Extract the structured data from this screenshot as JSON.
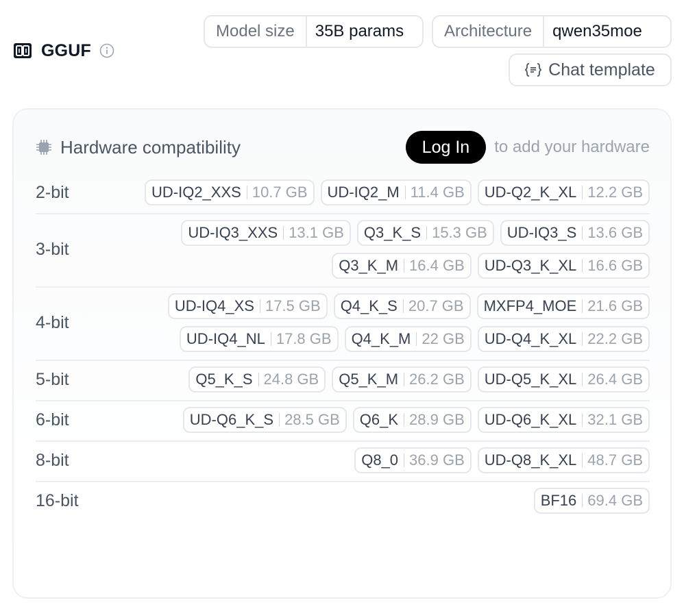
{
  "header": {
    "title": "GGUF",
    "model_size_label": "Model size",
    "model_size_value": "35B params",
    "architecture_label": "Architecture",
    "architecture_value": "qwen35moe",
    "chat_template_label": "Chat template"
  },
  "hardware": {
    "title": "Hardware compatibility",
    "login_label": "Log In",
    "hint": "to add your hardware"
  },
  "quant_rows": [
    {
      "bits": "2-bit",
      "items": [
        {
          "name": "UD-IQ2_XXS",
          "size": "10.7 GB"
        },
        {
          "name": "UD-IQ2_M",
          "size": "11.4 GB"
        },
        {
          "name": "UD-Q2_K_XL",
          "size": "12.2 GB"
        }
      ]
    },
    {
      "bits": "3-bit",
      "items": [
        {
          "name": "UD-IQ3_XXS",
          "size": "13.1 GB"
        },
        {
          "name": "Q3_K_S",
          "size": "15.3 GB"
        },
        {
          "name": "UD-IQ3_S",
          "size": "13.6 GB"
        },
        {
          "name": "Q3_K_M",
          "size": "16.4 GB"
        },
        {
          "name": "UD-Q3_K_XL",
          "size": "16.6 GB"
        }
      ]
    },
    {
      "bits": "4-bit",
      "items": [
        {
          "name": "UD-IQ4_XS",
          "size": "17.5 GB"
        },
        {
          "name": "Q4_K_S",
          "size": "20.7 GB"
        },
        {
          "name": "MXFP4_MOE",
          "size": "21.6 GB"
        },
        {
          "name": "UD-IQ4_NL",
          "size": "17.8 GB"
        },
        {
          "name": "Q4_K_M",
          "size": "22 GB"
        },
        {
          "name": "UD-Q4_K_XL",
          "size": "22.2 GB"
        }
      ]
    },
    {
      "bits": "5-bit",
      "items": [
        {
          "name": "Q5_K_S",
          "size": "24.8 GB"
        },
        {
          "name": "Q5_K_M",
          "size": "26.2 GB"
        },
        {
          "name": "UD-Q5_K_XL",
          "size": "26.4 GB"
        }
      ]
    },
    {
      "bits": "6-bit",
      "items": [
        {
          "name": "UD-Q6_K_S",
          "size": "28.5 GB"
        },
        {
          "name": "Q6_K",
          "size": "28.9 GB"
        },
        {
          "name": "UD-Q6_K_XL",
          "size": "32.1 GB"
        }
      ]
    },
    {
      "bits": "8-bit",
      "items": [
        {
          "name": "Q8_0",
          "size": "36.9 GB"
        },
        {
          "name": "UD-Q8_K_XL",
          "size": "48.7 GB"
        }
      ]
    },
    {
      "bits": "16-bit",
      "items": [
        {
          "name": "BF16",
          "size": "69.4 GB"
        }
      ]
    }
  ],
  "icons": {
    "logo": "gguf-logo-icon",
    "info": "info-icon",
    "chat": "code-braces-icon",
    "hardware": "chip-icon"
  }
}
